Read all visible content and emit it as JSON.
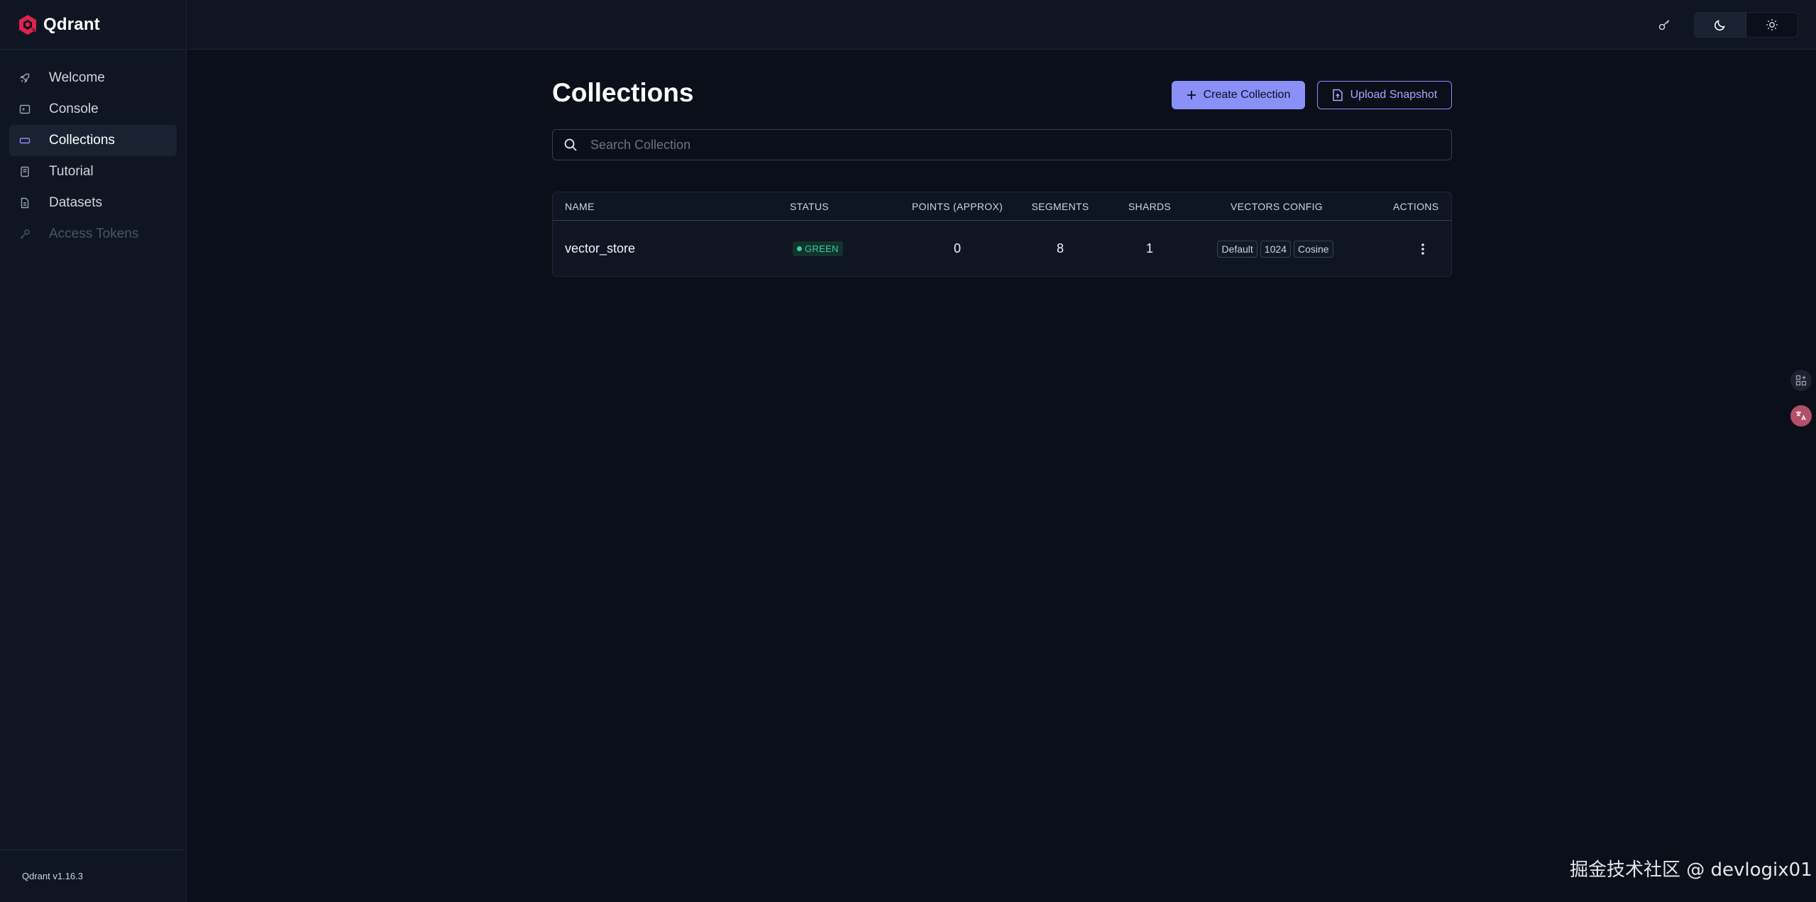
{
  "brand": {
    "name": "Qdrant",
    "accent": "#dc244c"
  },
  "sidebar": {
    "items": [
      {
        "label": "Welcome",
        "icon": "rocket-icon"
      },
      {
        "label": "Console",
        "icon": "terminal-icon"
      },
      {
        "label": "Collections",
        "icon": "collection-icon",
        "active": true
      },
      {
        "label": "Tutorial",
        "icon": "book-icon"
      },
      {
        "label": "Datasets",
        "icon": "file-icon"
      },
      {
        "label": "Access Tokens",
        "icon": "key-icon",
        "disabled": true
      }
    ],
    "version": "Qdrant v1.16.3"
  },
  "topbar": {
    "api_key_icon": "key-icon",
    "theme": {
      "dark_icon": "moon-icon",
      "light_icon": "sun-icon",
      "selected": "dark"
    }
  },
  "page": {
    "title": "Collections",
    "create_button": "Create Collection",
    "upload_button": "Upload Snapshot",
    "search_placeholder": "Search Collection",
    "accent_color": "#8b8ff8"
  },
  "table": {
    "columns": [
      "NAME",
      "STATUS",
      "POINTS (APPROX)",
      "SEGMENTS",
      "SHARDS",
      "VECTORS CONFIG",
      "ACTIONS"
    ],
    "rows": [
      {
        "name": "vector_store",
        "status": "GREEN",
        "points": "0",
        "segments": "8",
        "shards": "1",
        "vectors": [
          "Default",
          "1024",
          "Cosine"
        ],
        "actions_icon": "kebab-menu-icon"
      }
    ]
  },
  "watermark": "掘金技术社区 @ devlogix01"
}
